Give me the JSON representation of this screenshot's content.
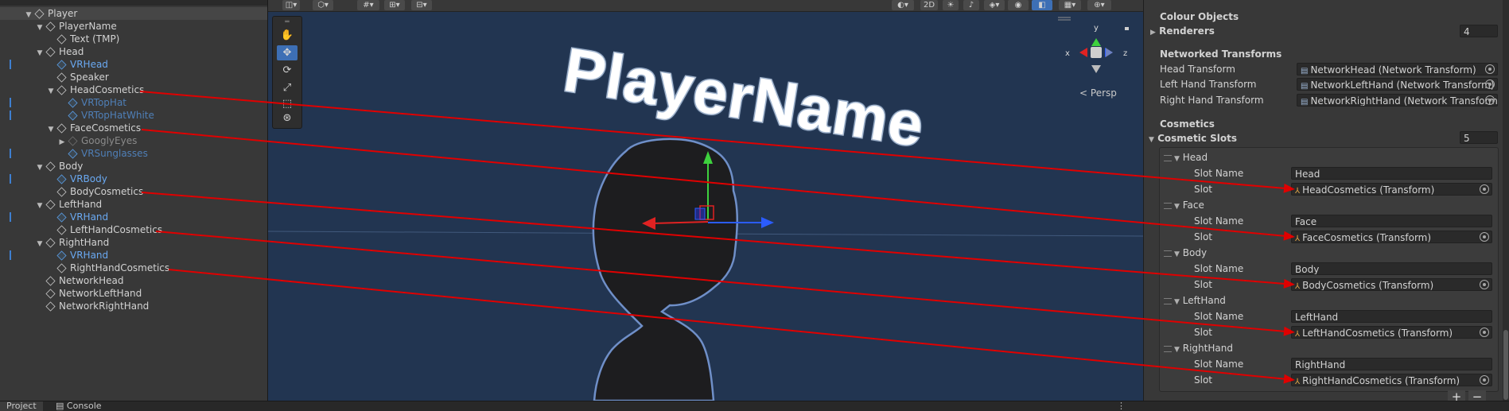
{
  "hierarchy": {
    "top_partial": "Player",
    "rows": [
      {
        "label": "Player",
        "indent": 0,
        "tri": "▼",
        "style": "normal",
        "selected": true,
        "mark": false
      },
      {
        "label": "PlayerName",
        "indent": 1,
        "tri": "▼",
        "style": "normal",
        "mark": false
      },
      {
        "label": "Text (TMP)",
        "indent": 2,
        "tri": "",
        "style": "normal",
        "mark": false
      },
      {
        "label": "Head",
        "indent": 1,
        "tri": "▼",
        "style": "normal",
        "mark": false
      },
      {
        "label": "VRHead",
        "indent": 2,
        "tri": "",
        "style": "blue",
        "mark": true
      },
      {
        "label": "Speaker",
        "indent": 2,
        "tri": "",
        "style": "normal",
        "mark": false
      },
      {
        "label": "HeadCosmetics",
        "indent": 2,
        "tri": "▼",
        "style": "normal",
        "mark": false
      },
      {
        "label": "VRTopHat",
        "indent": 3,
        "tri": "",
        "style": "dimblue",
        "mark": true
      },
      {
        "label": "VRTopHatWhite",
        "indent": 3,
        "tri": "",
        "style": "dimblue",
        "mark": true
      },
      {
        "label": "FaceCosmetics",
        "indent": 2,
        "tri": "▼",
        "style": "normal",
        "mark": false
      },
      {
        "label": "GooglyEyes",
        "indent": 3,
        "tri": "▶",
        "style": "dim",
        "mark": false
      },
      {
        "label": "VRSunglasses",
        "indent": 3,
        "tri": "",
        "style": "dimblue",
        "mark": true
      },
      {
        "label": "Body",
        "indent": 1,
        "tri": "▼",
        "style": "normal",
        "mark": false
      },
      {
        "label": "VRBody",
        "indent": 2,
        "tri": "",
        "style": "blue",
        "mark": true
      },
      {
        "label": "BodyCosmetics",
        "indent": 2,
        "tri": "",
        "style": "normal",
        "mark": false
      },
      {
        "label": "LeftHand",
        "indent": 1,
        "tri": "▼",
        "style": "normal",
        "mark": false
      },
      {
        "label": "VRHand",
        "indent": 2,
        "tri": "",
        "style": "blue",
        "mark": true
      },
      {
        "label": "LeftHandCosmetics",
        "indent": 2,
        "tri": "",
        "style": "normal",
        "mark": false
      },
      {
        "label": "RightHand",
        "indent": 1,
        "tri": "▼",
        "style": "normal",
        "mark": false
      },
      {
        "label": "VRHand",
        "indent": 2,
        "tri": "",
        "style": "blue",
        "mark": true
      },
      {
        "label": "RightHandCosmetics",
        "indent": 2,
        "tri": "",
        "style": "normal",
        "mark": false
      },
      {
        "label": "NetworkHead",
        "indent": 1,
        "tri": "",
        "style": "normal",
        "mark": false
      },
      {
        "label": "NetworkLeftHand",
        "indent": 1,
        "tri": "",
        "style": "normal",
        "mark": false
      },
      {
        "label": "NetworkRightHand",
        "indent": 1,
        "tri": "",
        "style": "normal",
        "mark": false
      }
    ]
  },
  "bottom_tabs": {
    "project": "Project",
    "console": "Console"
  },
  "scene": {
    "toolbar": {
      "mode_2d": "2D"
    },
    "persp_label": "Persp",
    "axis_labels": {
      "x": "x",
      "y": "y",
      "z": "z"
    },
    "world_text": "PlayerName",
    "tools": [
      "hand-icon",
      "move-icon",
      "rotate-icon",
      "scale-icon",
      "rect-icon",
      "transform-icon"
    ]
  },
  "inspector": {
    "colour_objects": "Colour Objects",
    "renderers_label": "Renderers",
    "renderers_value": "4",
    "networked_transforms": "Networked Transforms",
    "head_transform_label": "Head Transform",
    "head_transform_value": "NetworkHead (Network Transform)",
    "left_hand_transform_label": "Left Hand Transform",
    "left_hand_transform_value": "NetworkLeftHand (Network Transform)",
    "right_hand_transform_label": "Right Hand Transform",
    "right_hand_transform_value": "NetworkRightHand (Network Transform",
    "cosmetics": "Cosmetics",
    "cosmetic_slots_label": "Cosmetic Slots",
    "cosmetic_slots_value": "5",
    "slot_name_label": "Slot Name",
    "slot_label": "Slot",
    "slots": [
      {
        "header": "Head",
        "slot_name": "Head",
        "slot": "HeadCosmetics (Transform)"
      },
      {
        "header": "Face",
        "slot_name": "Face",
        "slot": "FaceCosmetics (Transform)"
      },
      {
        "header": "Body",
        "slot_name": "Body",
        "slot": "BodyCosmetics (Transform)"
      },
      {
        "header": "LeftHand",
        "slot_name": "LeftHand",
        "slot": "LeftHandCosmetics (Transform)"
      },
      {
        "header": "RightHand",
        "slot_name": "RightHand",
        "slot": "RightHandCosmetics (Transform)"
      }
    ],
    "add_label": "+",
    "remove_label": "−"
  },
  "colors": {
    "annotation_arrow": "#e00000",
    "scene_bg": "#223551",
    "selection_blue": "#3d6fb5"
  }
}
